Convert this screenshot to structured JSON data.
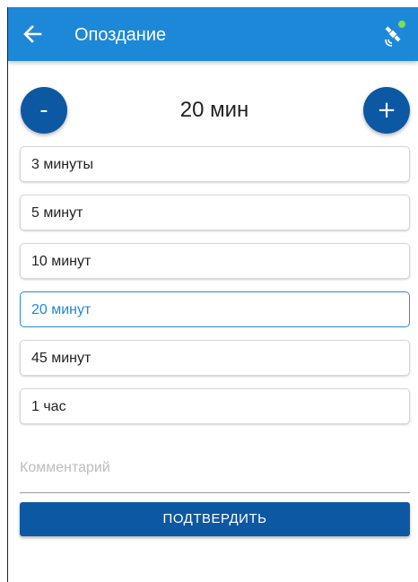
{
  "appbar": {
    "title": "Опоздание",
    "back_icon": "arrow-left-icon",
    "status_icon": "satellite-gps-icon",
    "status_dot_color": "#7ee04a",
    "background_color": "#1e88d8"
  },
  "stepper": {
    "minus_label": "-",
    "plus_label": "+",
    "value": "20 мин",
    "button_color": "#0d58a2"
  },
  "options": [
    {
      "label": "3 минуты",
      "selected": false
    },
    {
      "label": "5 минут",
      "selected": false
    },
    {
      "label": "10 минут",
      "selected": false
    },
    {
      "label": "20 минут",
      "selected": true
    },
    {
      "label": "45 минут",
      "selected": false
    },
    {
      "label": "1 час",
      "selected": false
    }
  ],
  "comment": {
    "placeholder": "Комментарий",
    "value": ""
  },
  "confirm": {
    "label": "ПОДТВЕРДИТЬ"
  }
}
